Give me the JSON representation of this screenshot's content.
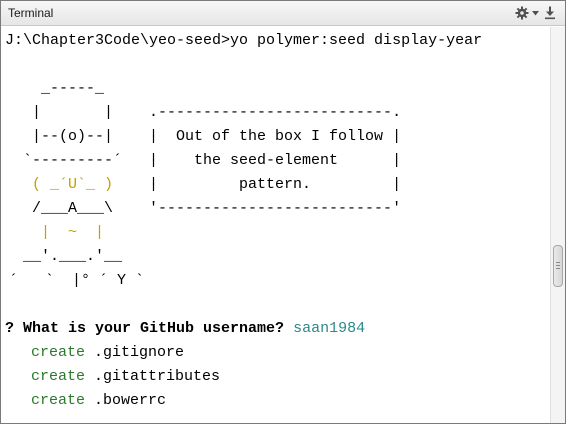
{
  "window": {
    "title": "Terminal"
  },
  "toolbar": {
    "settings_icon": "gear-icon",
    "settings_menu_icon": "chevron-down-icon",
    "hide_icon": "minimize-to-bottom-icon"
  },
  "terminal": {
    "prompt_line": "J:\\Chapter3Code\\yeo-seed>yo polymer:seed display-year",
    "ascii_lines": [
      "    _-----_",
      "   |       |    .--------------------------.",
      "   |--(o)--|    |  Out of the box I follow |",
      "  `---------´   |    the seed-element      |",
      "   ( _´U`_ )    |         pattern.         |",
      "   /___A___\\    '--------------------------'",
      "    |  ~  |",
      "  __'.___.'__",
      "´   `  |° ´ Y `"
    ],
    "question": {
      "marker": "?",
      "text": " What is your GitHub username? ",
      "answer": "saan1984"
    },
    "create_lines": [
      {
        "verb": "create",
        "file": ".gitignore"
      },
      {
        "verb": "create",
        "file": ".gitattributes"
      },
      {
        "verb": "create",
        "file": ".bowerrc"
      }
    ]
  },
  "colors": {
    "answer": "#2a8a8a",
    "create_verb": "#2a7a2a",
    "yeoman_face": "#c4a000"
  }
}
